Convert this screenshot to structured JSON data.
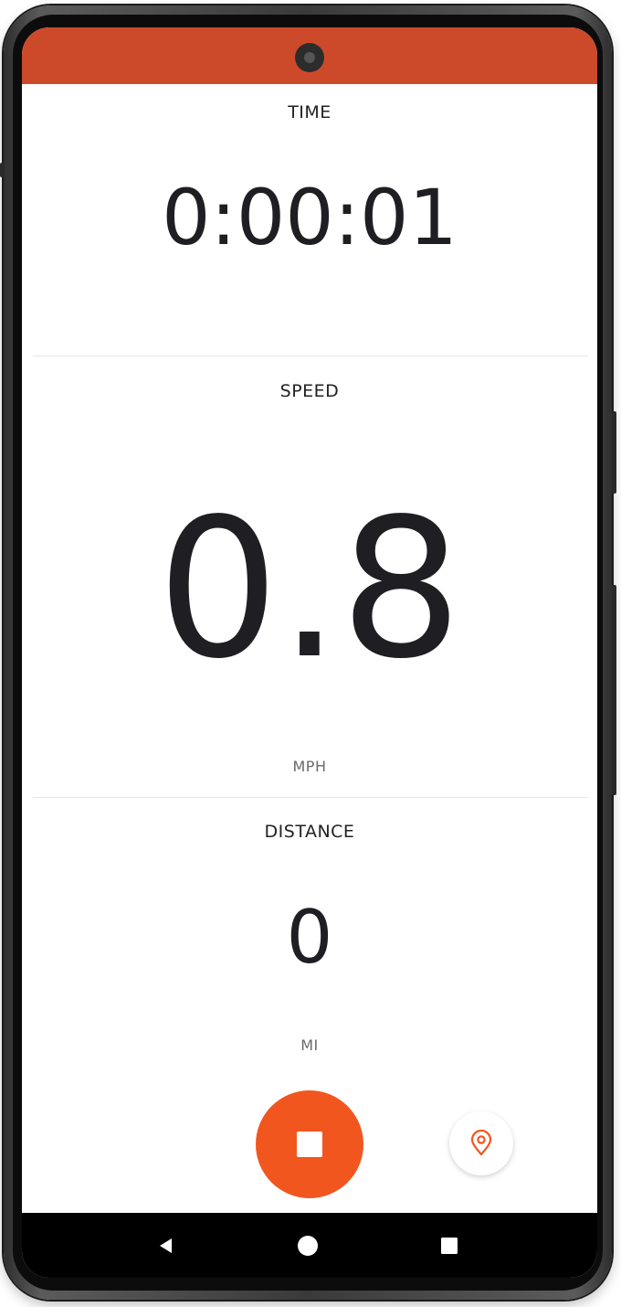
{
  "app": {
    "accent_color": "#f2561f",
    "status_bar_color": "#cc4a2a"
  },
  "time": {
    "label": "TIME",
    "value": "0:00:01"
  },
  "speed": {
    "label": "SPEED",
    "value": "0.8",
    "unit": "MPH"
  },
  "distance": {
    "label": "DISTANCE",
    "value": "0",
    "unit": "MI"
  },
  "controls": {
    "stop_icon": "stop-icon",
    "location_icon": "map-pin-icon"
  },
  "nav": {
    "back_icon": "back-triangle-icon",
    "home_icon": "home-circle-icon",
    "recents_icon": "recents-square-icon"
  }
}
